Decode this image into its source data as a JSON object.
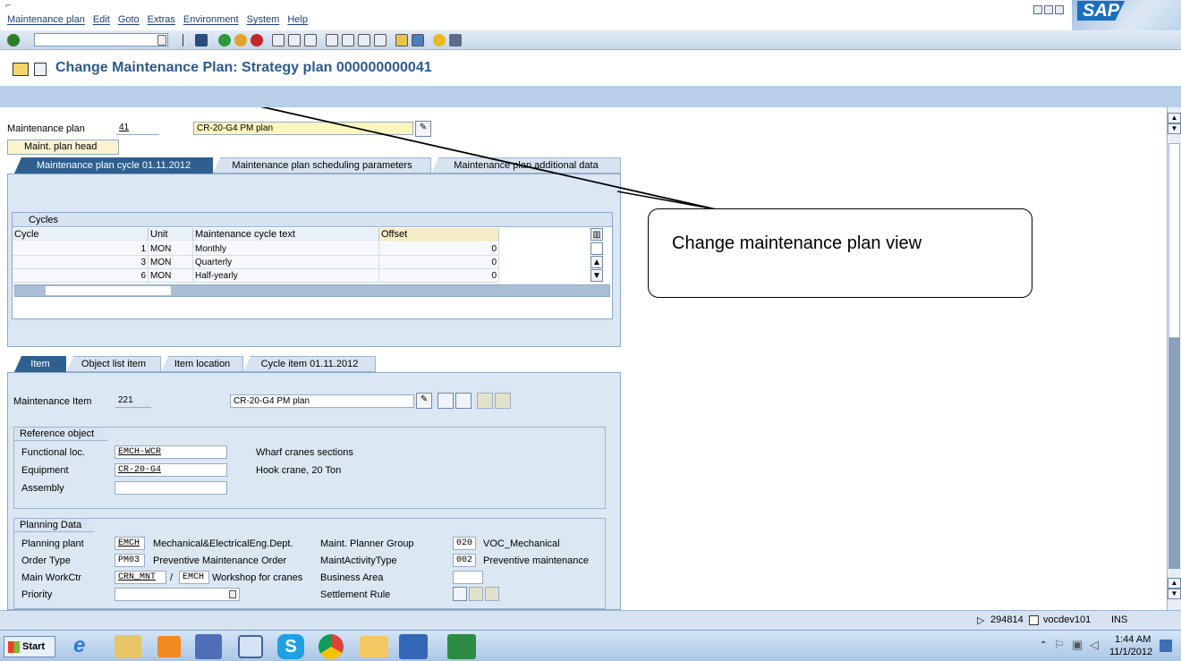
{
  "menu": {
    "items": [
      "Maintenance plan",
      "Edit",
      "Goto",
      "Extras",
      "Environment",
      "System",
      "Help"
    ],
    "logo": "SAP"
  },
  "title": "Change Maintenance Plan: Strategy plan 000000000041",
  "header": {
    "plan_label": "Maintenance plan",
    "plan_number": "41",
    "plan_text": "CR-20-G4 PM plan",
    "head_button": "Maint. plan head"
  },
  "tabs_top": [
    "Maintenance plan cycle 01.11.2012",
    "Maintenance plan scheduling parameters",
    "Maintenance plan additional data"
  ],
  "cycles": {
    "title": "Cycles",
    "columns": [
      "Cycle",
      "Unit",
      "Maintenance cycle text",
      "Offset"
    ],
    "rows": [
      {
        "cycle": "1",
        "unit": "MON",
        "text": "Monthly",
        "offset": "0"
      },
      {
        "cycle": "3",
        "unit": "MON",
        "text": "Quarterly",
        "offset": "0"
      },
      {
        "cycle": "6",
        "unit": "MON",
        "text": "Half-yearly",
        "offset": "0"
      }
    ]
  },
  "tabs_bottom": [
    "Item",
    "Object list item",
    "Item location",
    "Cycle item 01.11.2012"
  ],
  "item": {
    "label": "Maintenance Item",
    "number": "221",
    "text": "CR-20-G4 PM plan"
  },
  "reference": {
    "title": "Reference object",
    "func_loc_label": "Functional loc.",
    "func_loc": "EMCH-WCR",
    "func_loc_desc": "Wharf cranes sections",
    "equip_label": "Equipment",
    "equip": "CR-20-G4",
    "equip_desc": "Hook crane, 20 Ton",
    "assembly_label": "Assembly"
  },
  "planning": {
    "title": "Planning Data",
    "plant_label": "Planning plant",
    "plant": "EMCH",
    "plant_desc": "Mechanical&ElectricalEng.Dept.",
    "order_label": "Order Type",
    "order": "PM03",
    "order_desc": "Preventive Maintenance Order",
    "workctr_label": "Main WorkCtr",
    "workctr": "CRN_MNT",
    "workctr_sep": "/",
    "workctr_plant": "EMCH",
    "workctr_desc": "Workshop for cranes",
    "priority_label": "Priority",
    "planner_label": "Maint. Planner Group",
    "planner": "020",
    "planner_desc": "VOC_Mechanical",
    "activity_label": "MaintActivityType",
    "activity": "002",
    "activity_desc": "Preventive maintenance",
    "business_label": "Business Area",
    "settlement_label": "Settlement Rule"
  },
  "annotation": "Change maintenance plan view",
  "status": {
    "session": "294814",
    "server": "vocdev101",
    "mode": "INS"
  },
  "taskbar": {
    "start": "Start",
    "time": "1:44 AM",
    "date": "11/1/2012"
  },
  "colors": {
    "title": "#2c5a8c",
    "app_bar": "#b8cfe8",
    "panel": "#dbe7f3",
    "active_tab": "#2f5f8f",
    "yellow_field": "#fff6bd"
  }
}
